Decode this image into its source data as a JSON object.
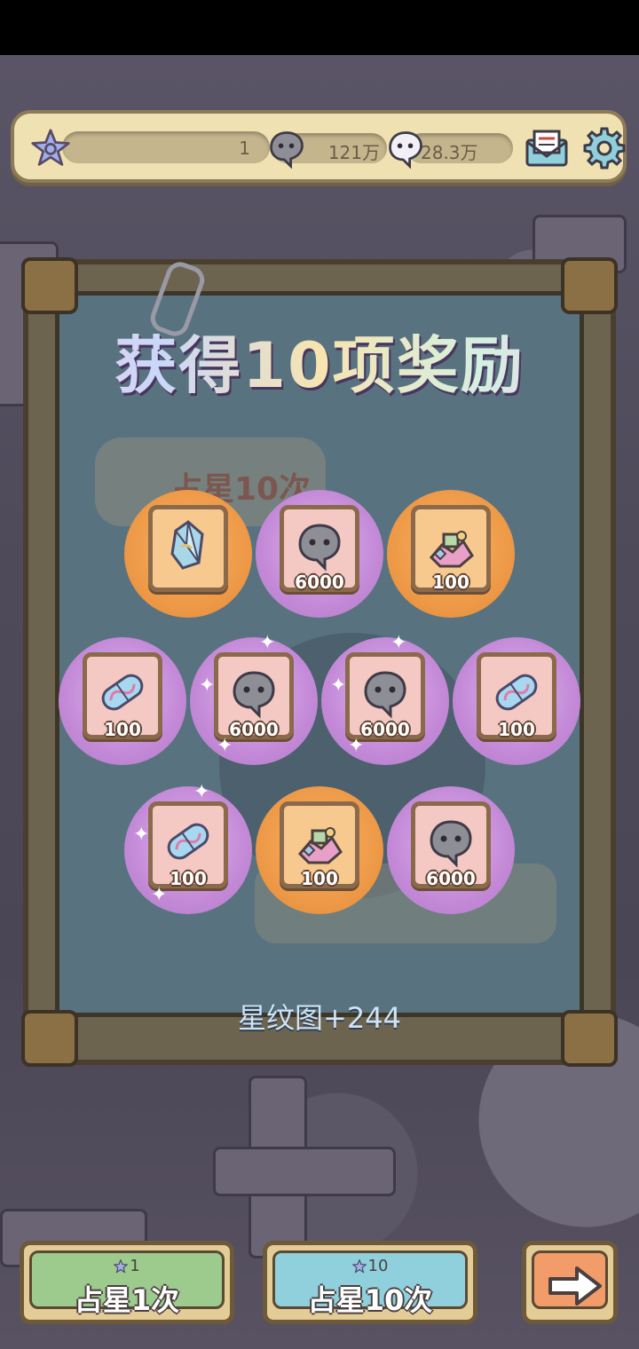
{
  "top_bar": {
    "level_value": "1",
    "currency_a": "121万",
    "currency_b": "28.3万",
    "icons": [
      "star-level-icon",
      "gray-ghost-icon",
      "white-ghost-icon",
      "mail-icon",
      "gear-icon"
    ]
  },
  "dialog": {
    "headline": "获得10项奖励",
    "background_label": "占星10次",
    "gain_text": "星纹图+244"
  },
  "rewards": [
    {
      "item": "crystal-shard-icon",
      "qty": "",
      "bg": "orange"
    },
    {
      "item": "gray-ghost-icon",
      "qty": "6000",
      "bg": "purple"
    },
    {
      "item": "gift-pile-icon",
      "qty": "100",
      "bg": "orange"
    },
    {
      "item": "crystal-capsule-icon",
      "qty": "100",
      "bg": "purple"
    },
    {
      "item": "gray-ghost-icon",
      "qty": "6000",
      "bg": "purple"
    },
    {
      "item": "gray-ghost-icon",
      "qty": "6000",
      "bg": "purple"
    },
    {
      "item": "crystal-capsule-icon",
      "qty": "100",
      "bg": "purple"
    },
    {
      "item": "crystal-capsule-icon",
      "qty": "100",
      "bg": "purple"
    },
    {
      "item": "gift-pile-icon",
      "qty": "100",
      "bg": "orange"
    },
    {
      "item": "gray-ghost-icon",
      "qty": "6000",
      "bg": "purple"
    }
  ],
  "buttons": {
    "single": {
      "cost": "1",
      "label": "占星1次"
    },
    "ten": {
      "cost": "10",
      "label": "占星10次"
    },
    "next_icon": "arrow-right-icon"
  },
  "colors": {
    "purple_orb": "#c48ad8",
    "orange_orb": "#ee9a48",
    "top_bar": "#efe1b2"
  }
}
